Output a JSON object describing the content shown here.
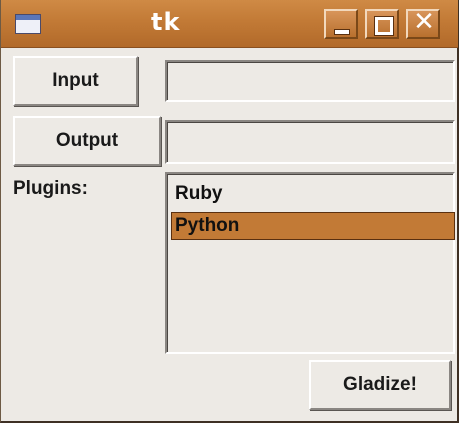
{
  "window": {
    "title": "tk",
    "controls": {
      "minimize_icon": "minimize-icon",
      "maximize_icon": "maximize-icon",
      "close_icon": "close-icon",
      "close_glyph": "✕"
    },
    "accent_color": "#c27a36"
  },
  "form": {
    "input_button_label": "Input",
    "input_value": "",
    "output_button_label": "Output",
    "output_value": "",
    "plugins_label": "Plugins:",
    "plugins": [
      {
        "label": "Ruby",
        "selected": false
      },
      {
        "label": "Python",
        "selected": true
      }
    ],
    "gladize_button_label": "Gladize!"
  }
}
